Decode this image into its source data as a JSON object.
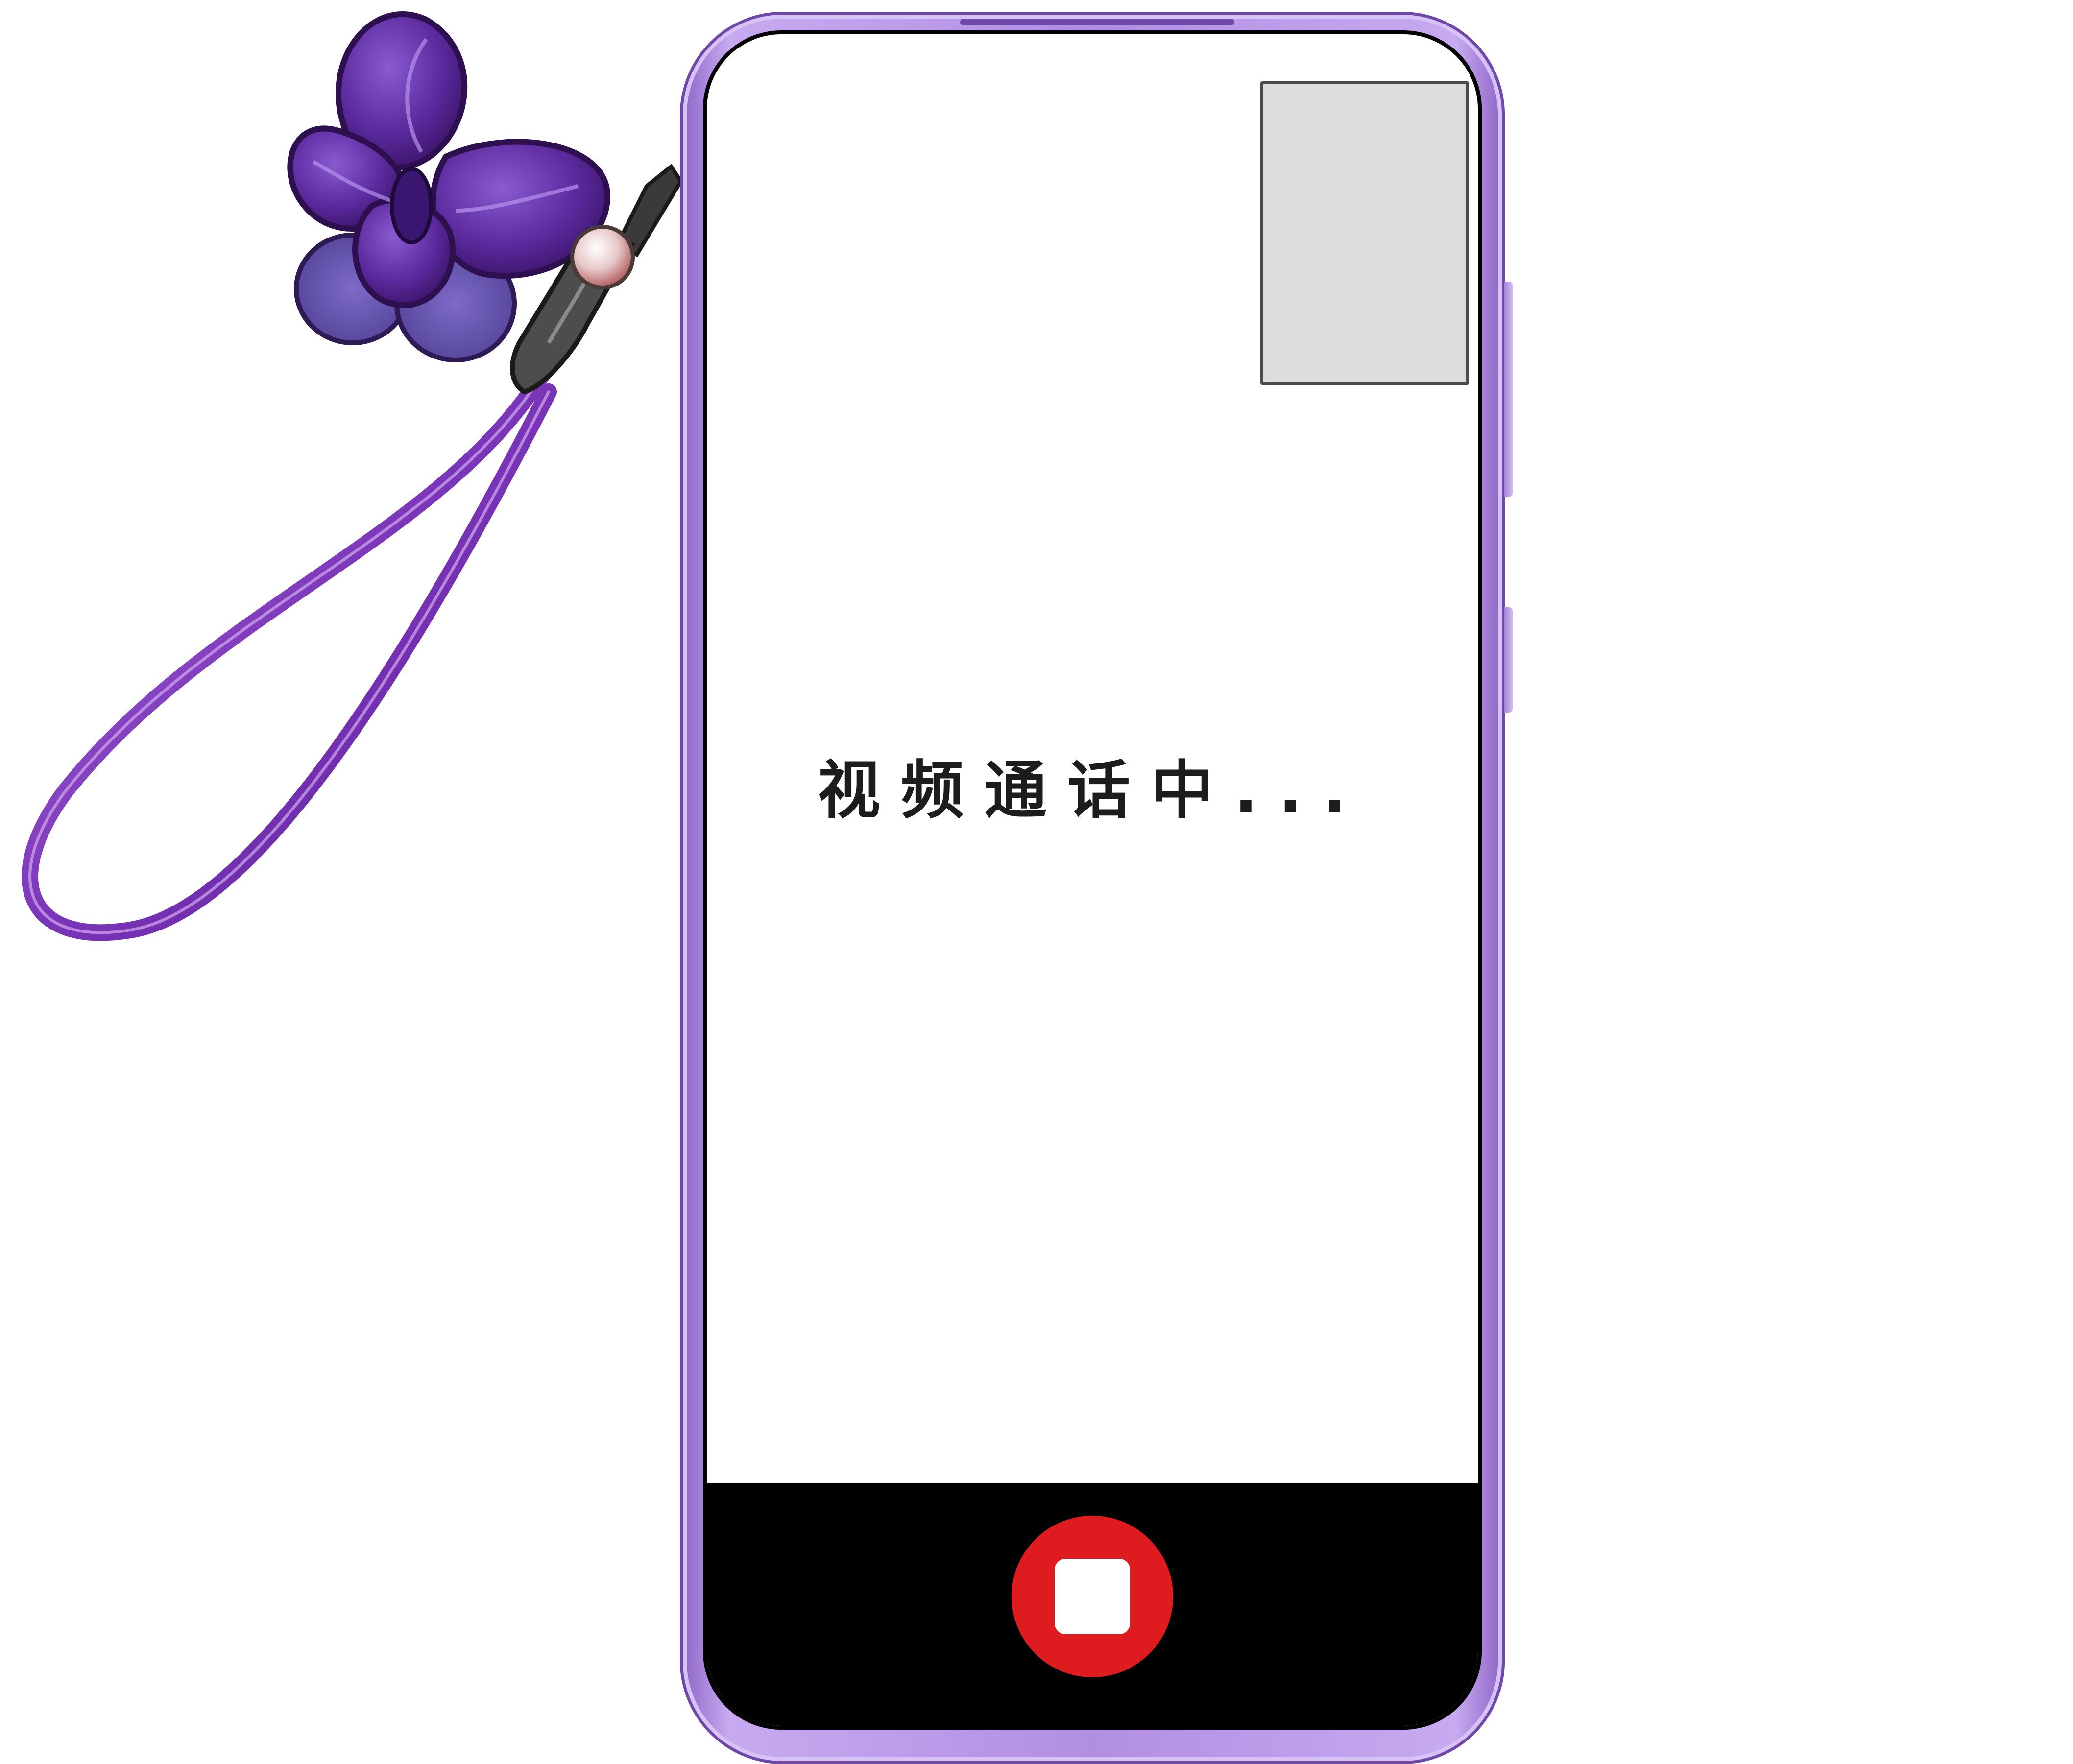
{
  "call": {
    "status_text": "视频通话中..."
  },
  "colors": {
    "phone_frame": "#b28ee3",
    "end_call": "#de1b1f",
    "control_bar": "#000000",
    "pip_placeholder": "#dcdcdc"
  },
  "icons": {
    "end_call": "stop-square-icon",
    "charm": "butterfly-icon"
  }
}
